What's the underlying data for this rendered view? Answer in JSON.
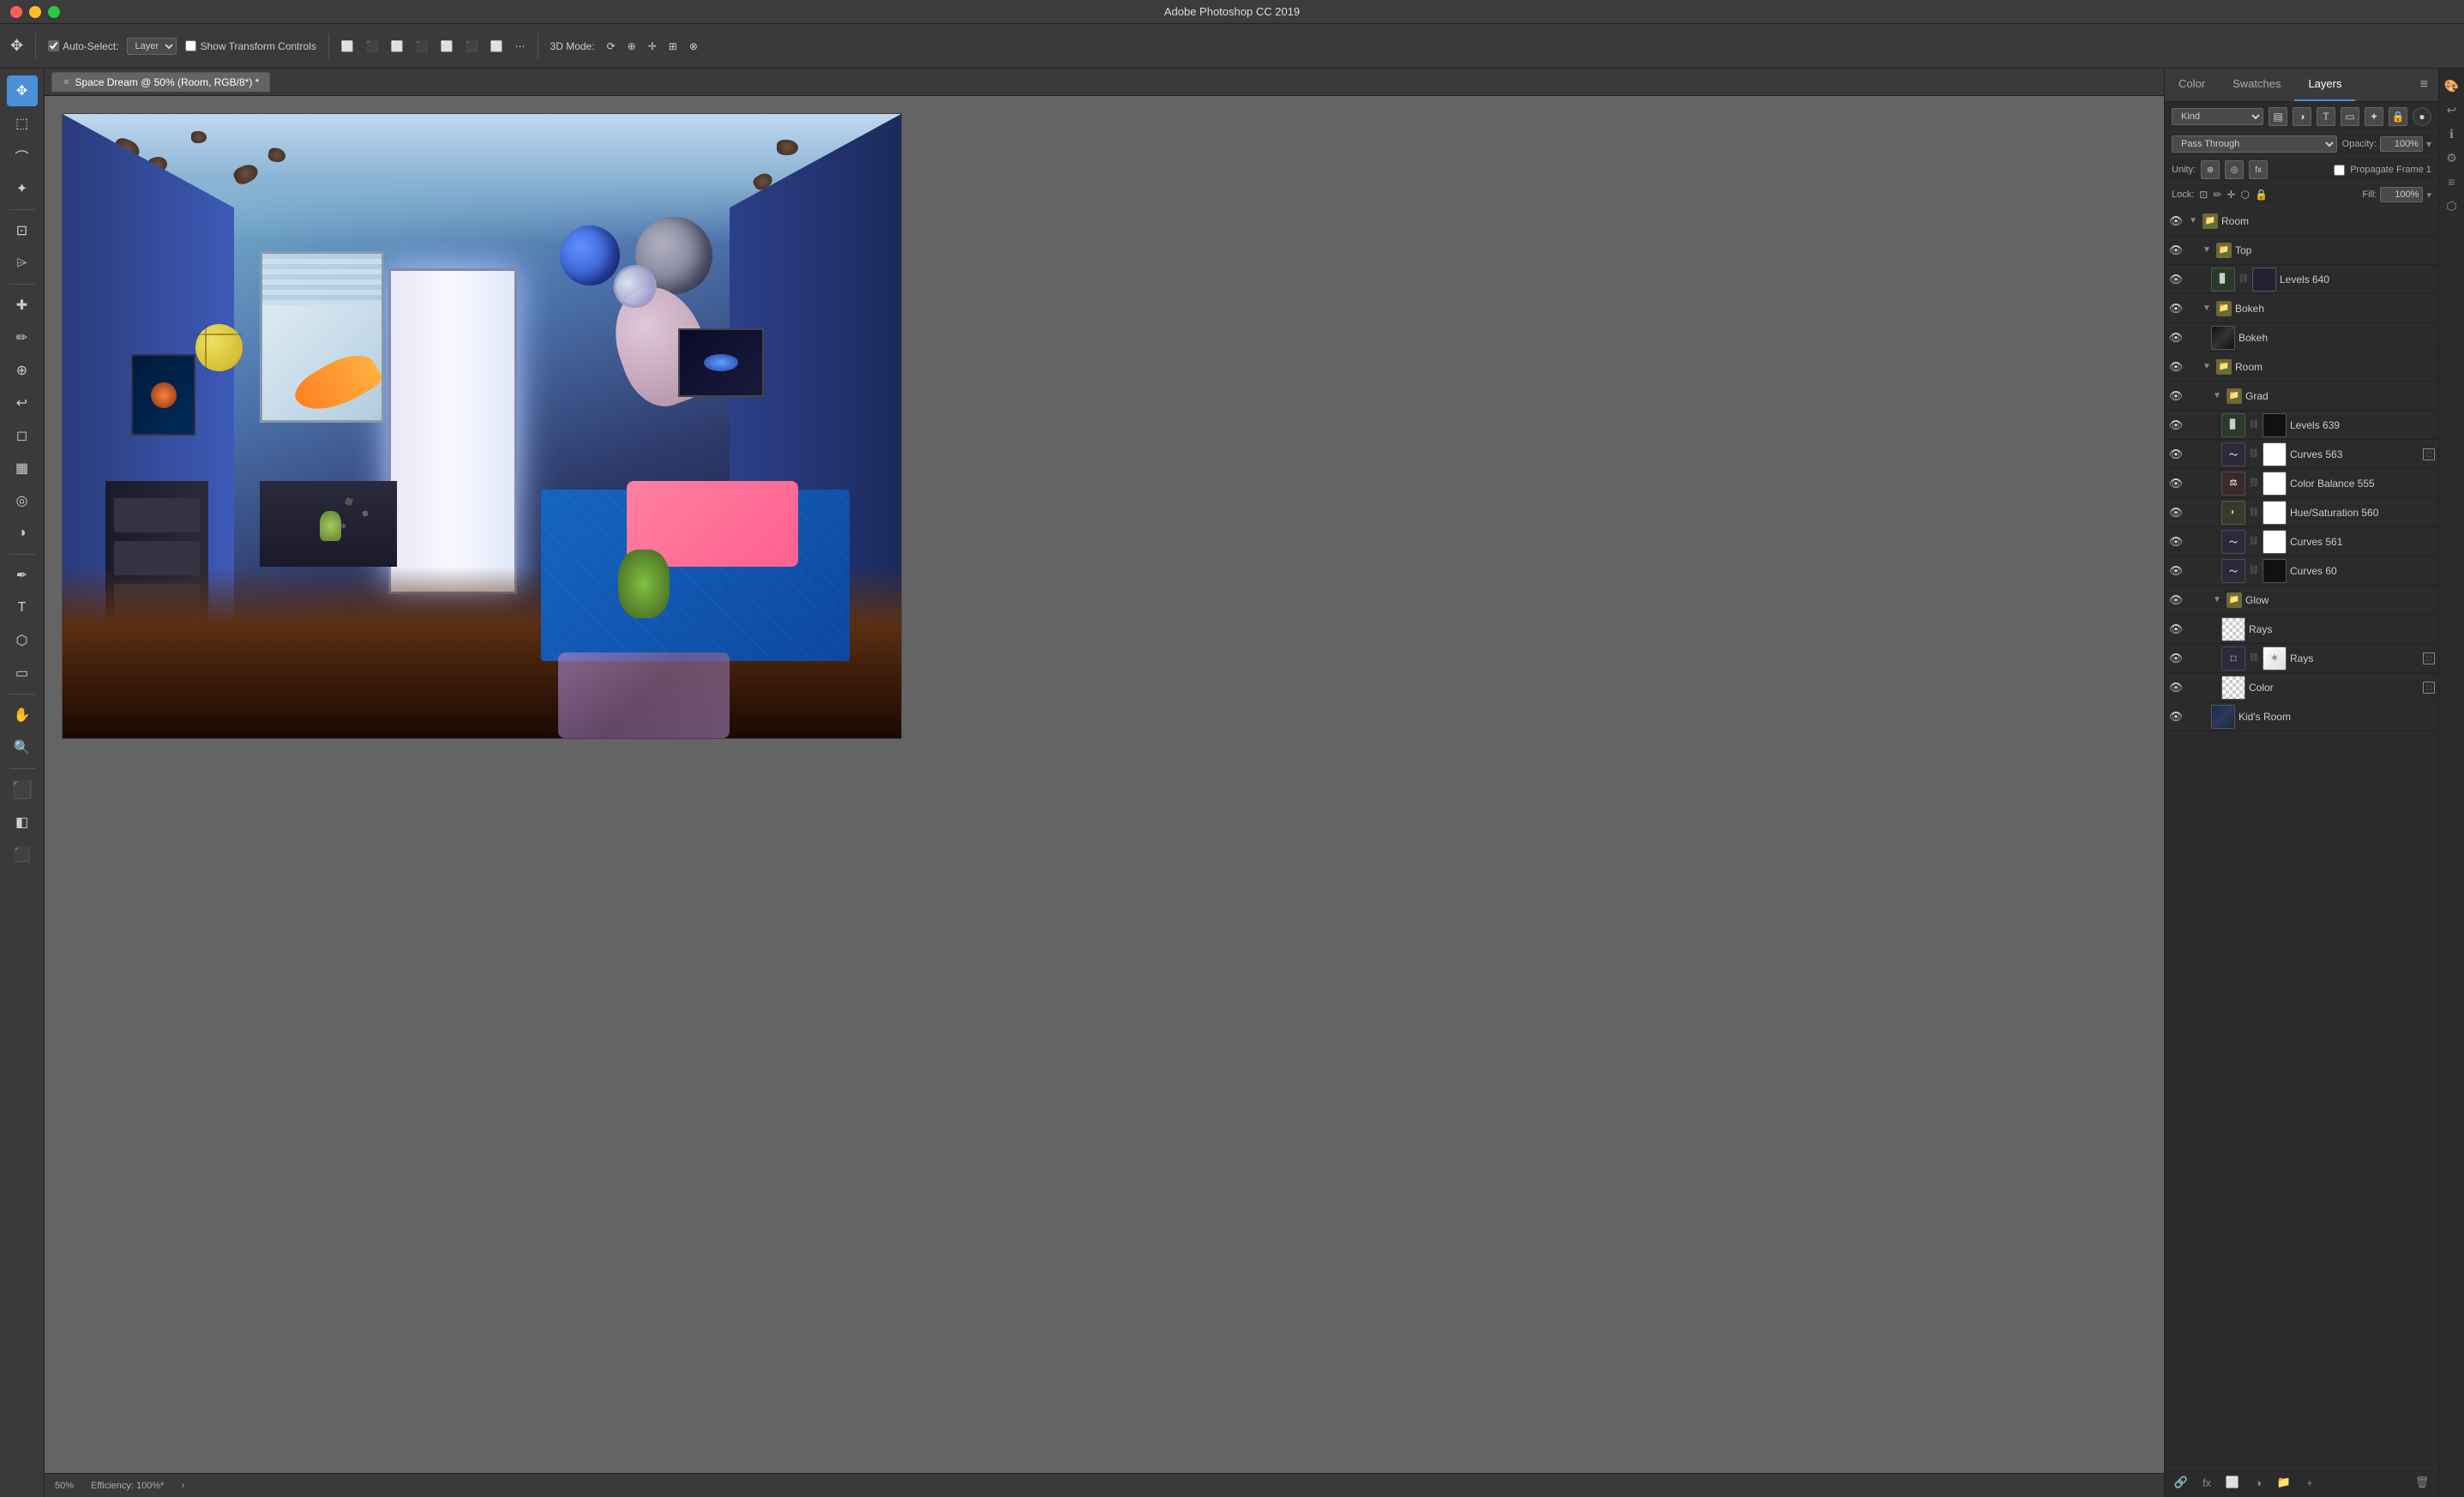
{
  "app": {
    "title": "Adobe Photoshop CC 2019",
    "tab_label": "Space Dream @ 50% (Room, RGB/8*) *"
  },
  "toolbar": {
    "auto_select_label": "Auto-Select:",
    "layer_label": "Layer",
    "show_transform_label": "Show Transform Controls",
    "three_d_label": "3D Mode:",
    "more_icon": "⋯"
  },
  "canvas": {
    "zoom": "50%",
    "status": "Efficiency: 100%*"
  },
  "panels": {
    "color_label": "Color",
    "swatches_label": "Swatches",
    "layers_label": "Layers"
  },
  "layers_panel": {
    "kind_label": "Kind",
    "blend_mode": "Pass Through",
    "opacity_label": "Opacity:",
    "opacity_value": "100%",
    "lock_label": "Lock:",
    "fill_label": "Fill:",
    "fill_value": "100%",
    "propagate_label": "Propagate Frame 1",
    "unity_label": "Unity:",
    "layers": [
      {
        "id": "room-group",
        "type": "group",
        "name": "Room",
        "indent": 0,
        "visible": true,
        "expanded": true
      },
      {
        "id": "top-group",
        "type": "group",
        "name": "Top",
        "indent": 1,
        "visible": true,
        "expanded": true
      },
      {
        "id": "levels-640",
        "type": "adjustment-levels",
        "name": "Levels 640",
        "indent": 2,
        "visible": true,
        "thumb": "dark"
      },
      {
        "id": "bokeh-group",
        "type": "group",
        "name": "Bokeh",
        "indent": 1,
        "visible": true,
        "expanded": false
      },
      {
        "id": "bokeh-layer",
        "type": "image",
        "name": "Bokeh",
        "indent": 2,
        "visible": true,
        "thumb": "image"
      },
      {
        "id": "room-group2",
        "type": "group",
        "name": "Room",
        "indent": 1,
        "visible": true,
        "expanded": true
      },
      {
        "id": "grad-group",
        "type": "group",
        "name": "Grad",
        "indent": 2,
        "visible": true,
        "expanded": true
      },
      {
        "id": "levels-639",
        "type": "adjustment-levels",
        "name": "Levels 639",
        "indent": 3,
        "visible": true,
        "thumb": "black"
      },
      {
        "id": "curves-563",
        "type": "adjustment-curves",
        "name": "Curves 563",
        "indent": 3,
        "visible": true,
        "thumb": "white",
        "clip": true
      },
      {
        "id": "color-balance-555",
        "type": "adjustment-colorbalance",
        "name": "Color Balance 555",
        "indent": 3,
        "visible": true,
        "thumb": "white"
      },
      {
        "id": "hue-sat-560",
        "type": "adjustment-huesat",
        "name": "Hue/Saturation 560",
        "indent": 3,
        "visible": true,
        "thumb": "white"
      },
      {
        "id": "curves-561",
        "type": "adjustment-curves",
        "name": "Curves 561",
        "indent": 3,
        "visible": true,
        "thumb": "white"
      },
      {
        "id": "curves-60",
        "type": "adjustment-curves",
        "name": "Curves 60",
        "indent": 3,
        "visible": true,
        "thumb": "black"
      },
      {
        "id": "glow-group",
        "type": "group",
        "name": "Glow",
        "indent": 2,
        "visible": true,
        "expanded": true
      },
      {
        "id": "rays-checker",
        "type": "solid",
        "name": "Rays",
        "indent": 3,
        "visible": true,
        "thumb": "checker"
      },
      {
        "id": "rays-adj",
        "type": "image",
        "name": "Rays",
        "indent": 3,
        "visible": true,
        "thumb": "image",
        "clip": true
      },
      {
        "id": "color-layer",
        "type": "solid",
        "name": "Color",
        "indent": 3,
        "visible": true,
        "thumb": "checker",
        "clip": true
      },
      {
        "id": "kids-room",
        "type": "image",
        "name": "Kid's Room",
        "indent": 2,
        "visible": true,
        "thumb": "image"
      }
    ]
  },
  "status_bar": {
    "zoom": "50%",
    "efficiency": "Efficiency: 100%*"
  },
  "tools": [
    {
      "id": "move",
      "icon": "✥",
      "active": true
    },
    {
      "id": "select-rect",
      "icon": "⬚"
    },
    {
      "id": "lasso",
      "icon": "⌒"
    },
    {
      "id": "quick-select",
      "icon": "✦"
    },
    {
      "id": "crop",
      "icon": "⊡"
    },
    {
      "id": "eyedropper",
      "icon": "⌲"
    },
    {
      "id": "healing",
      "icon": "✚"
    },
    {
      "id": "brush",
      "icon": "✏"
    },
    {
      "id": "clone",
      "icon": "⊕"
    },
    {
      "id": "history",
      "icon": "↩"
    },
    {
      "id": "eraser",
      "icon": "◻"
    },
    {
      "id": "gradient",
      "icon": "▦"
    },
    {
      "id": "blur",
      "icon": "◎"
    },
    {
      "id": "dodge",
      "icon": "◑"
    },
    {
      "id": "pen",
      "icon": "✒"
    },
    {
      "id": "text",
      "icon": "T"
    },
    {
      "id": "path-select",
      "icon": "⬡"
    },
    {
      "id": "rect-shape",
      "icon": "▭"
    },
    {
      "id": "hand",
      "icon": "✋"
    },
    {
      "id": "zoom",
      "icon": "🔍"
    },
    {
      "id": "foreground",
      "icon": "⬛"
    },
    {
      "id": "switch",
      "icon": "⇄"
    },
    {
      "id": "quick-mask",
      "icon": "◧"
    },
    {
      "id": "screen-mode",
      "icon": "⬛"
    },
    {
      "id": "artboard",
      "icon": "⊞"
    }
  ]
}
